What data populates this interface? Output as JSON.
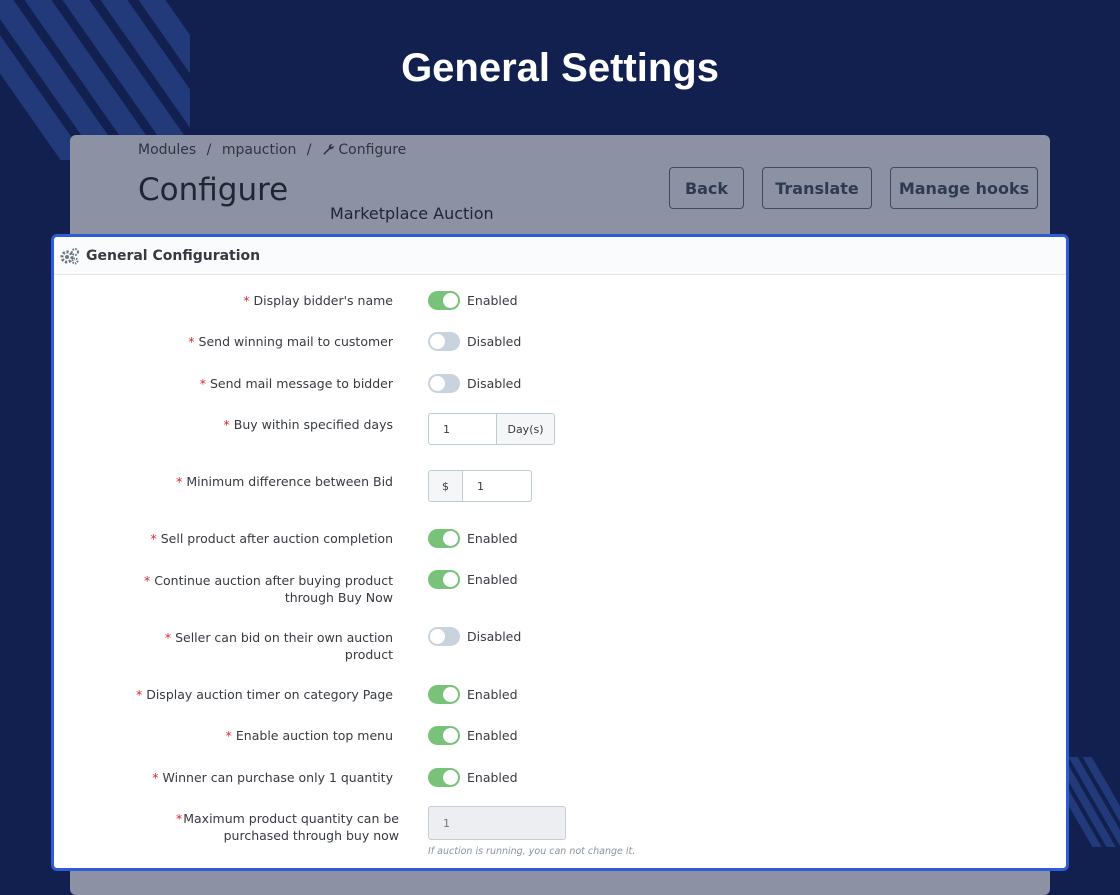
{
  "page": {
    "heading": "General Settings"
  },
  "breadcrumb": {
    "items": [
      "Modules",
      "/",
      "mpauction",
      "/"
    ],
    "current": "Configure",
    "current_icon": "wrench-icon"
  },
  "header": {
    "title": "Configure",
    "module_name": "Marketplace Auction",
    "buttons": {
      "back": "Back",
      "translate": "Translate",
      "manage_hooks": "Manage hooks"
    }
  },
  "card": {
    "title": "General Configuration",
    "icon": "gears-icon"
  },
  "required_mark": "*",
  "fields": {
    "bidder_name": {
      "label": "Display bidder's name",
      "state": "Enabled",
      "on": true
    },
    "winning_mail": {
      "label": "Send winning mail to customer",
      "state": "Disabled",
      "on": false
    },
    "mail_bidder": {
      "label": "Send mail message to bidder",
      "state": "Disabled",
      "on": false
    },
    "buy_days": {
      "label": "Buy within specified days",
      "value": "1",
      "suffix": "Day(s)"
    },
    "min_diff": {
      "label": "Minimum difference between Bid",
      "prefix": "$",
      "value": "1"
    },
    "sell_after": {
      "label": "Sell product after auction completion",
      "state": "Enabled",
      "on": true
    },
    "continue_auction": {
      "label_line1": "Continue auction after buying product",
      "label_line2": "through Buy Now",
      "state": "Enabled",
      "on": true
    },
    "seller_bid": {
      "label_line1": "Seller can bid on their own auction",
      "label_line2": "product",
      "state": "Disabled",
      "on": false
    },
    "timer_category": {
      "label": "Display auction timer on category Page",
      "state": "Enabled",
      "on": true
    },
    "top_menu": {
      "label": "Enable auction top menu",
      "state": "Enabled",
      "on": true
    },
    "winner_qty": {
      "label": "Winner can purchase only 1 quantity",
      "state": "Enabled",
      "on": true
    },
    "max_qty": {
      "label_line1": "Maximum product quantity can be",
      "label_line2": "purchased through buy now",
      "value": "1",
      "hint": "If auction is running, you can not change it."
    }
  },
  "colors": {
    "background": "#12204f",
    "toggle_on": "#78c279",
    "toggle_off": "#c9d3de",
    "card_border": "#2f5bd6",
    "required": "#e0252f"
  }
}
